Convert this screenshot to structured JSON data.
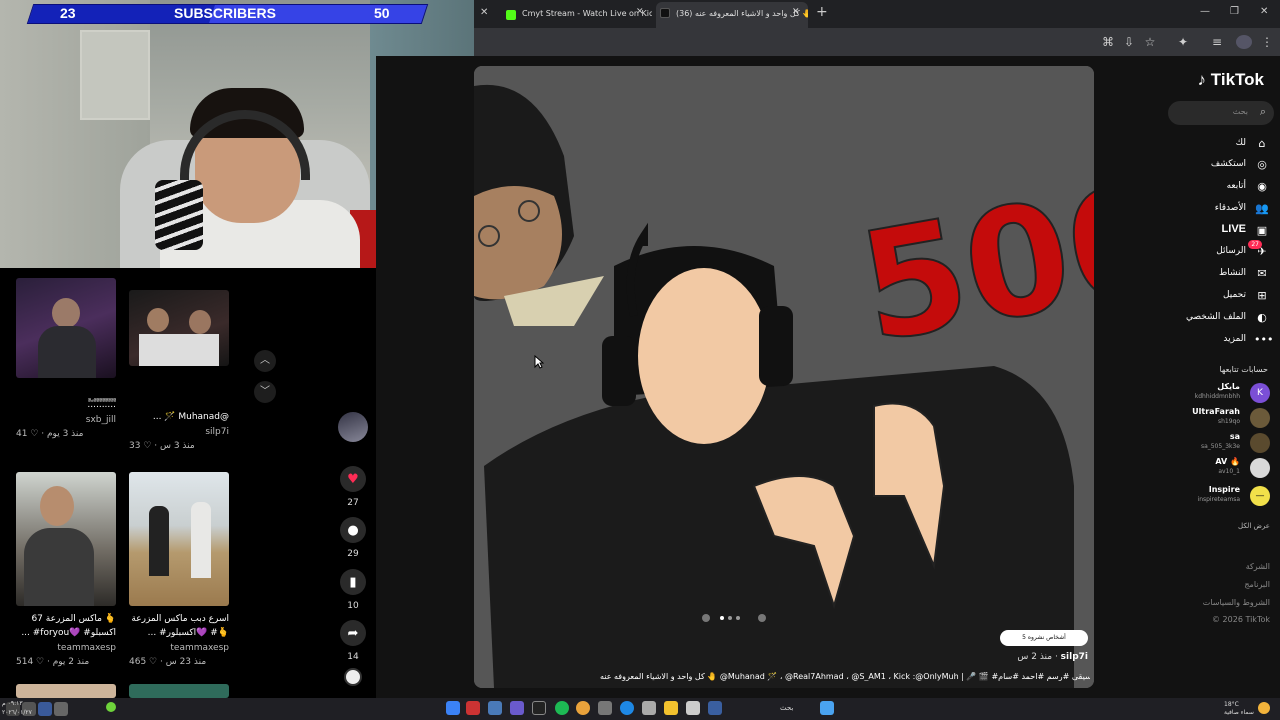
{
  "overlay": {
    "sub_current": "23",
    "sub_label": "SUBSCRIBERS",
    "sub_goal": "50",
    "sub_progress": 0.46
  },
  "browser": {
    "tabs": [
      {
        "label": "Cmyt Stream - Watch Live on Kick",
        "favicon_color": "#53fc18"
      },
      {
        "label": "(36) كل واحد و الاشياء المعروفه عنه 🤚",
        "favicon_color": "#111111"
      }
    ],
    "new_tab": "+"
  },
  "grid": {
    "cards": [
      {
        "title": "ًًًًًًًًًًًًًًًًًًًًًًًًًًًًًًًًًً",
        "title2": "ً.ً.ً.ًً.ًً.ًً.ًً.ًً.ًً.ًً.ًً",
        "author": "sxb_jill",
        "meta": "41 ♡ · منذ 3 يوم"
      },
      {
        "title": "ًًًًًًًًًًًًًًًًًًًًًًًًًًًًًًًً",
        "title2": "... 🪄 Muhanad@",
        "author": "silp7i",
        "meta": "33 ♡ · منذ 3 س"
      },
      {
        "title": "67 ماكس المزرعة 🫰",
        "title2": "... #foryou💜 #اكسبلو",
        "author": "teammaxesp",
        "meta": "514 ♡ · منذ 2 يوم"
      },
      {
        "title": "اسرع دبب ماكس المزرعة",
        "title2": "... #اكسبلور💜 #🫰",
        "author": "teammaxesp",
        "meta": "465 ♡ · منذ 23 س"
      }
    ]
  },
  "video": {
    "sticker_text": "500",
    "author": "silp7i",
    "time": "منذ 2 س",
    "caption": "كل واحد و الاشياء المعروفه عنه 🤚 @Muhanad 🪄 ، @Real7Ahmad ، @S_AM1 ، Kick :@OnlyMuh | 🎤 🎬 #مهندات. #بدون_موسيقى #رسم #احمد #سام",
    "repost": "5 أشخاص نشروه",
    "likes": "27",
    "comments": "29",
    "saves": "10",
    "shares": "14"
  },
  "sidebar": {
    "logo": "TikTok",
    "search_placeholder": "بحث",
    "nav": [
      {
        "label": "لك",
        "icon": "home-icon"
      },
      {
        "label": "استكشف",
        "icon": "compass-icon"
      },
      {
        "label": "أتابعه",
        "icon": "following-icon"
      },
      {
        "label": "الأصدقاء",
        "icon": "friends-icon"
      },
      {
        "label": "LIVE",
        "icon": "live-icon"
      },
      {
        "label": "الرسائل",
        "icon": "messages-icon",
        "badge": "27"
      },
      {
        "label": "النشاط",
        "icon": "activity-icon"
      },
      {
        "label": "تحميل",
        "icon": "upload-icon"
      },
      {
        "label": "الملف الشخصي",
        "icon": "profile-icon"
      },
      {
        "label": "المزيد",
        "icon": "more-icon"
      }
    ],
    "following_title": "حسابات تتابعها",
    "following": [
      {
        "name": "مايكل",
        "handle": "kdhhiddmnbhh",
        "color": "#7b4fd6",
        "initial": "K"
      },
      {
        "name": "UltraFarah",
        "handle": "sh19qo",
        "color": "#6b5a3a",
        "initial": ""
      },
      {
        "name": "sa",
        "handle": "sa_505_3k3e",
        "color": "#5a4a2e",
        "initial": ""
      },
      {
        "name": "AV 🔥",
        "handle": "av10_1",
        "color": "#d9d9d9",
        "initial": ""
      },
      {
        "name": "Inspire",
        "handle": "inspireteamsa",
        "color": "#f1e04a",
        "initial": "—"
      }
    ],
    "show_more": "عرض الكل",
    "footer": [
      "الشركة",
      "البرنامج",
      "الشروط والسياسات",
      "© 2026 TikTok"
    ]
  },
  "taskbar": {
    "search": "بحث",
    "weather_temp": "18°C",
    "weather_desc": "سماء صافية",
    "time_line1": "٠٩:١٣ م",
    "time_line2": "٢٠٢٦/٠١/٢٧"
  }
}
